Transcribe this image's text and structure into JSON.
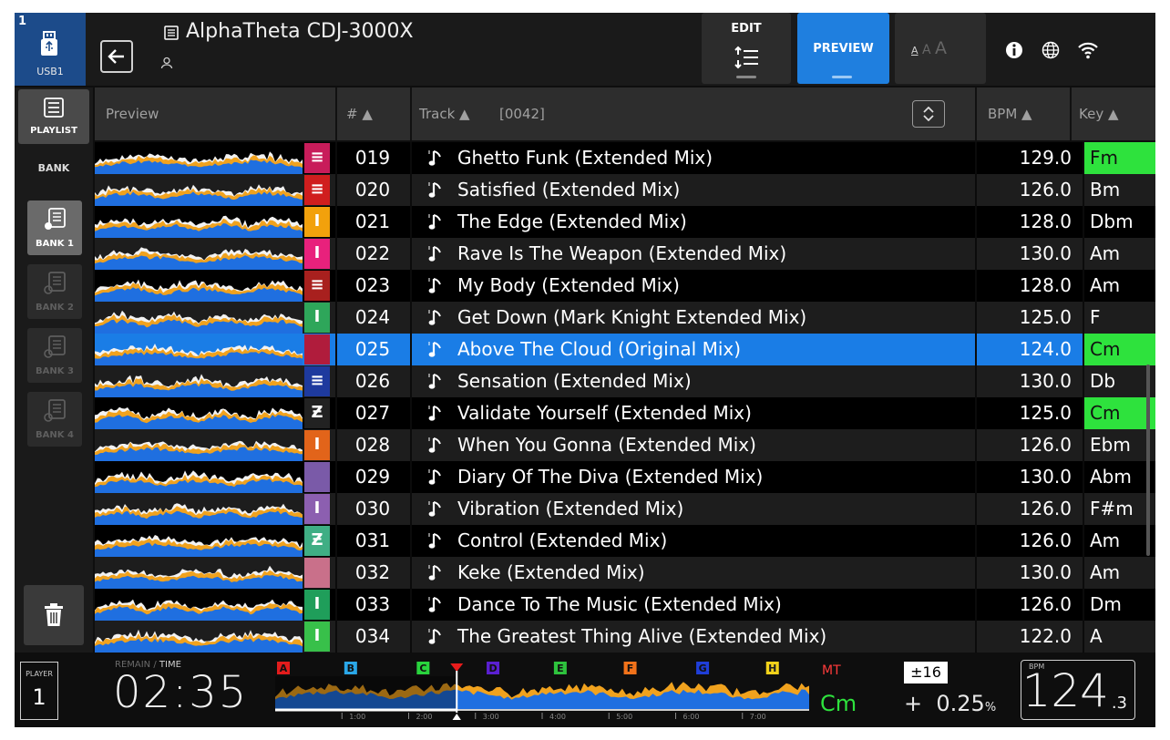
{
  "topbar": {
    "usb_number": "1",
    "usb_label": "USB1",
    "title": "AlphaTheta CDJ-3000X",
    "edit_label": "EDIT",
    "preview_label": "PREVIEW",
    "font_size_glyph": "A"
  },
  "sidebar": {
    "playlist_label": "PLAYLIST",
    "bank_heading": "BANK",
    "banks": [
      {
        "label": "BANK 1",
        "active": true
      },
      {
        "label": "BANK 2",
        "active": false
      },
      {
        "label": "BANK 3",
        "active": false
      },
      {
        "label": "BANK 4",
        "active": false
      }
    ]
  },
  "table": {
    "headers": {
      "preview": "Preview",
      "number": "# ▲",
      "track": "Track ▲",
      "track_count": "[0042]",
      "bpm": "BPM ▲",
      "key": "Key ▲"
    },
    "rows": [
      {
        "num": "019",
        "title": "Ghetto Funk (Extended Mix)",
        "bpm": "129.0",
        "key": "Fm",
        "key_highlight": true,
        "art": "#c81c5a",
        "art_glyph": "≡"
      },
      {
        "num": "020",
        "title": "Satisfied (Extended Mix)",
        "bpm": "126.0",
        "key": "Bm",
        "key_highlight": false,
        "art": "#d01e1e",
        "art_glyph": "≡"
      },
      {
        "num": "021",
        "title": "The Edge (Extended Mix)",
        "bpm": "128.0",
        "key": "Dbm",
        "key_highlight": false,
        "art": "#f2a10c",
        "art_glyph": "I"
      },
      {
        "num": "022",
        "title": "Rave Is The Weapon (Extended Mix)",
        "bpm": "130.0",
        "key": "Am",
        "key_highlight": false,
        "art": "#e8217c",
        "art_glyph": "I"
      },
      {
        "num": "023",
        "title": "My Body (Extended Mix)",
        "bpm": "128.0",
        "key": "Am",
        "key_highlight": false,
        "art": "#a8201e",
        "art_glyph": "≡"
      },
      {
        "num": "024",
        "title": "Get Down (Mark Knight Extended Mix)",
        "bpm": "125.0",
        "key": "F",
        "key_highlight": false,
        "art": "#2ea65a",
        "art_glyph": "I"
      },
      {
        "num": "025",
        "title": "Above The Cloud (Original Mix)",
        "bpm": "124.0",
        "key": "Cm",
        "key_highlight": true,
        "selected": true,
        "art": "#b01c3c",
        "art_glyph": ""
      },
      {
        "num": "026",
        "title": "Sensation (Extended Mix)",
        "bpm": "130.0",
        "key": "Db",
        "key_highlight": false,
        "art": "#1e3a9e",
        "art_glyph": "≡"
      },
      {
        "num": "027",
        "title": "Validate Yourself (Extended Mix)",
        "bpm": "125.0",
        "key": "Cm",
        "key_highlight": true,
        "art": "#222222",
        "art_glyph": "Ƶ"
      },
      {
        "num": "028",
        "title": "When You Gonna (Extended Mix)",
        "bpm": "126.0",
        "key": "Ebm",
        "key_highlight": false,
        "art": "#e2641a",
        "art_glyph": "I"
      },
      {
        "num": "029",
        "title": "Diary Of The Diva (Extended Mix)",
        "bpm": "130.0",
        "key": "Abm",
        "key_highlight": false,
        "art": "#7a5aa8",
        "art_glyph": ""
      },
      {
        "num": "030",
        "title": "Vibration (Extended Mix)",
        "bpm": "126.0",
        "key": "F#m",
        "key_highlight": false,
        "art": "#8c5fb0",
        "art_glyph": "I"
      },
      {
        "num": "031",
        "title": "Control (Extended Mix)",
        "bpm": "126.0",
        "key": "Am",
        "key_highlight": false,
        "art": "#3fae84",
        "art_glyph": "Ƶ"
      },
      {
        "num": "032",
        "title": "Keke (Extended Mix)",
        "bpm": "130.0",
        "key": "Am",
        "key_highlight": false,
        "art": "#c9708a",
        "art_glyph": ""
      },
      {
        "num": "033",
        "title": "Dance To The Music (Extended Mix)",
        "bpm": "126.0",
        "key": "Dm",
        "key_highlight": false,
        "art": "#1f9e5a",
        "art_glyph": "I"
      },
      {
        "num": "034",
        "title": "The Greatest Thing Alive (Extended Mix)",
        "bpm": "122.0",
        "key": "A",
        "key_highlight": false,
        "art": "#38c04a",
        "art_glyph": "I"
      }
    ]
  },
  "bottombar": {
    "player_label": "PLAYER",
    "player_number": "1",
    "remain_label": "REMAIN",
    "time_label": "TIME",
    "time": "02:35",
    "playhead_fraction": 0.34,
    "cue_points": [
      {
        "label": "A",
        "color": "#e21c1c",
        "fraction": 0.0
      },
      {
        "label": "B",
        "color": "#2aa7e8",
        "fraction": 0.13
      },
      {
        "label": "C",
        "color": "#29d33d",
        "fraction": 0.27
      },
      {
        "label": "D",
        "color": "#5a1fd1",
        "fraction": 0.405
      },
      {
        "label": "E",
        "color": "#2ec23d",
        "fraction": 0.535
      },
      {
        "label": "F",
        "color": "#f2721a",
        "fraction": 0.67
      },
      {
        "label": "G",
        "color": "#1f3ed8",
        "fraction": 0.81
      },
      {
        "label": "H",
        "color": "#f2d21a",
        "fraction": 0.945
      }
    ],
    "ticks": [
      "1:00",
      "2:00",
      "3:00",
      "4:00",
      "5:00",
      "6:00",
      "7:00"
    ],
    "mt_label": "MT",
    "master_key": "Cm",
    "tempo_range": "±16",
    "pitch_sign": "+",
    "pitch_value": "0.25",
    "pitch_unit": "%",
    "bpm_label": "BPM",
    "bpm_integer": "124",
    "bpm_decimal": ".3"
  }
}
